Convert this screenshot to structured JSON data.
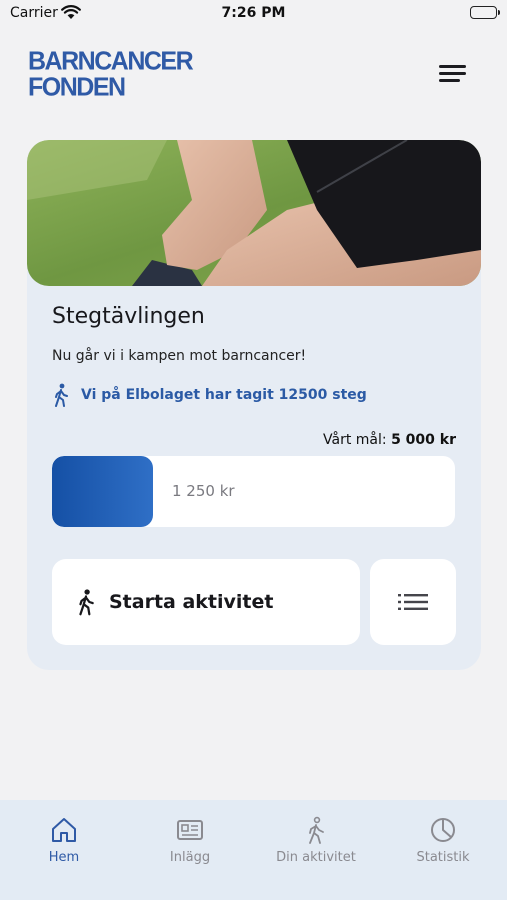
{
  "status_bar": {
    "carrier": "Carrier",
    "time": "7:26 PM"
  },
  "header": {
    "logo_line1": "BARNCANCER",
    "logo_line2": "FONDEN",
    "menu_icon": "hamburger-menu-icon"
  },
  "colors": {
    "brand_blue": "#2f5aa6",
    "progress_fill": "#1550a5",
    "card_bg": "#e6ecf4",
    "tabbar_bg": "#e3ebf4"
  },
  "campaign": {
    "title": "Stegtävlingen",
    "subtitle": "Nu går vi i kampen mot barncancer!",
    "steps_text": "Vi på Elbolaget  har tagit 12500 steg",
    "goal_label": "Vårt mål:",
    "goal_value": "5 000 kr",
    "raised": "1 250 kr",
    "progress_fraction": 0.25,
    "start_button": "Starta aktivitet",
    "list_icon": "list-icon"
  },
  "tabs": [
    {
      "label": "Hem",
      "icon": "home-icon",
      "active": true
    },
    {
      "label": "Inlägg",
      "icon": "news-icon",
      "active": false
    },
    {
      "label": "Din aktivitet",
      "icon": "walking-icon",
      "active": false
    },
    {
      "label": "Statistik",
      "icon": "pie-chart-icon",
      "active": false
    }
  ]
}
